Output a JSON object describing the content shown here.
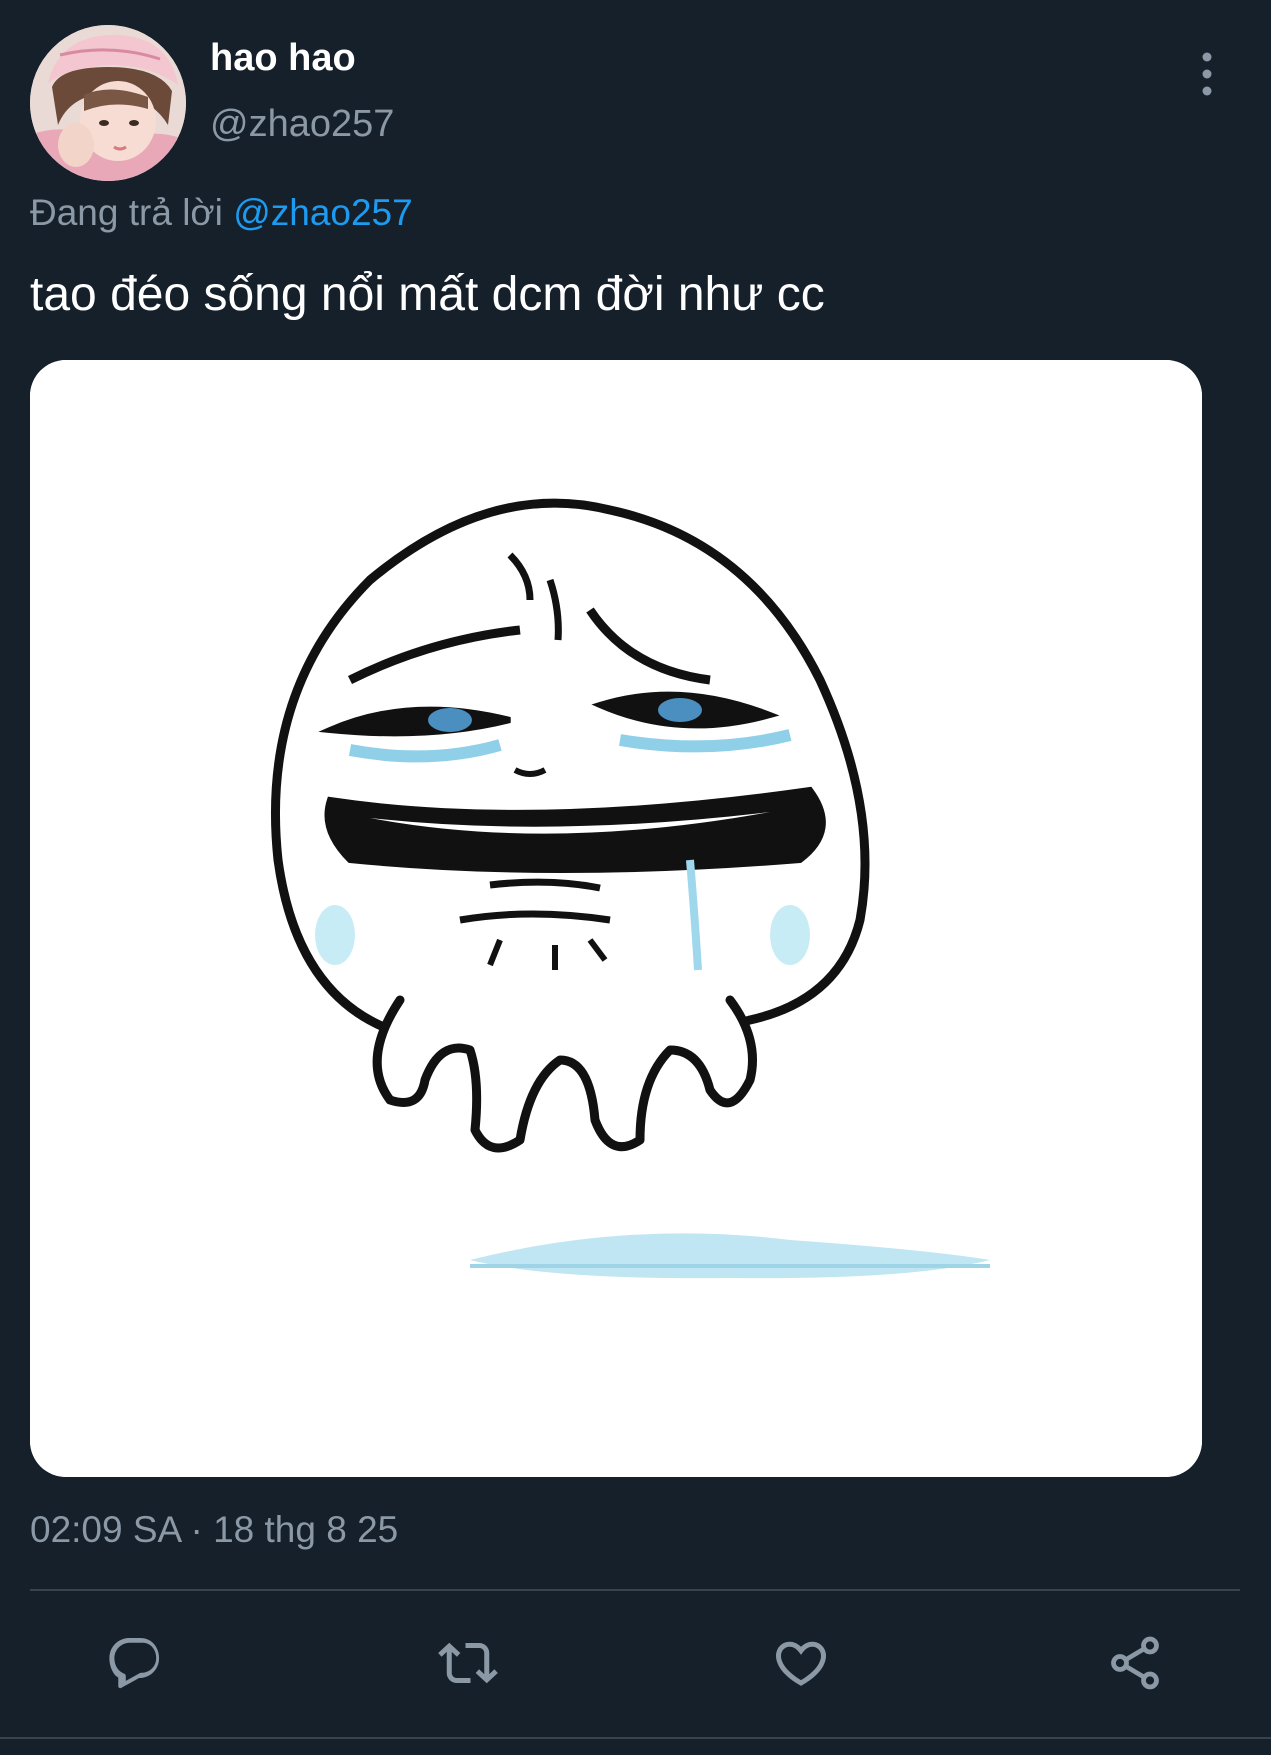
{
  "tweet": {
    "author": {
      "display_name": "hao hao",
      "handle": "@zhao257"
    },
    "reply_prefix": "Đang trả lời ",
    "reply_mention": "@zhao257",
    "text": "tao đéo sống nổi mất dcm đời như cc",
    "timestamp": "02:09 SA · 18 thg 8 25"
  },
  "icons": {
    "more": "more-vertical-icon",
    "reply": "reply-icon",
    "retweet": "retweet-icon",
    "like": "like-icon",
    "share": "share-icon"
  },
  "colors": {
    "background": "#15202b",
    "text_primary": "#ffffff",
    "text_secondary": "#8b98a5",
    "accent": "#1d9bf0",
    "divider": "#38444d"
  }
}
